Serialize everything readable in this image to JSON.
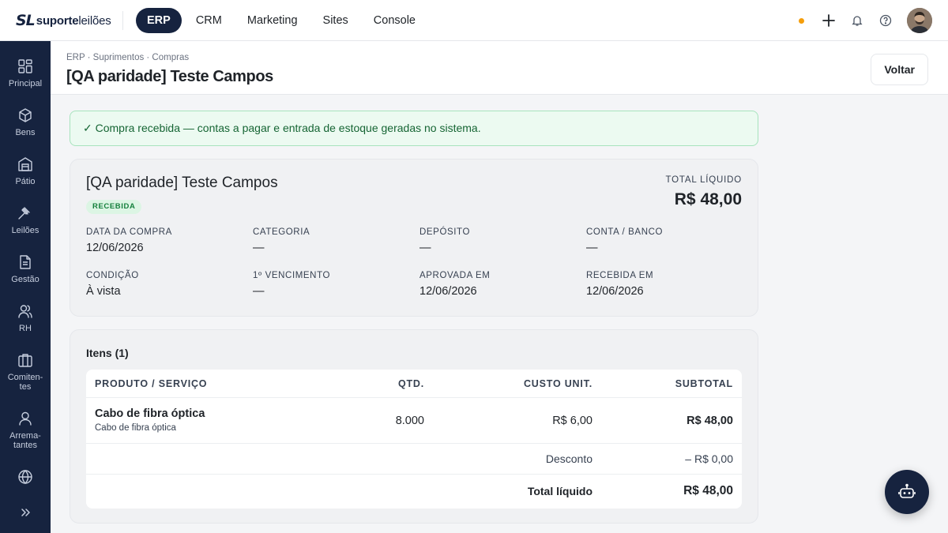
{
  "brand": {
    "mark": "SL",
    "name_bold": "suporte",
    "name_light": "leilões"
  },
  "topnav": [
    "ERP",
    "CRM",
    "Marketing",
    "Sites",
    "Console"
  ],
  "sidebar": [
    {
      "label": "Principal",
      "icon": "grid-icon"
    },
    {
      "label": "Bens",
      "icon": "box-icon"
    },
    {
      "label": "Pátio",
      "icon": "warehouse-icon"
    },
    {
      "label": "Leilões",
      "icon": "gavel-icon"
    },
    {
      "label": "Gestão",
      "icon": "document-icon"
    },
    {
      "label": "RH",
      "icon": "users-icon"
    },
    {
      "label": "Comiten-\ntes",
      "icon": "briefcase-icon"
    },
    {
      "label": "Arrema-\ntantes",
      "icon": "user-icon"
    },
    {
      "label": "",
      "icon": "globe-icon"
    }
  ],
  "header": {
    "breadcrumb": "ERP · Suprimentos · Compras",
    "title": "[QA paridade] Teste Campos",
    "back_label": "Voltar"
  },
  "alert": "✓ Compra recebida — contas a pagar e entrada de estoque geradas no sistema.",
  "summary": {
    "title": "[QA paridade] Teste Campos",
    "status": "RECEBIDA",
    "total_label": "TOTAL LÍQUIDO",
    "total_value": "R$ 48,00",
    "fields": [
      {
        "label": "DATA DA COMPRA",
        "value": "12/06/2026"
      },
      {
        "label": "CATEGORIA",
        "value": "—"
      },
      {
        "label": "DEPÓSITO",
        "value": "—"
      },
      {
        "label": "CONTA / BANCO",
        "value": "—"
      },
      {
        "label": "CONDIÇÃO",
        "value": "À vista"
      },
      {
        "label": "1º VENCIMENTO",
        "value": "—"
      },
      {
        "label": "APROVADA EM",
        "value": "12/06/2026"
      },
      {
        "label": "RECEBIDA EM",
        "value": "12/06/2026"
      }
    ]
  },
  "items": {
    "title": "Itens (1)",
    "columns": [
      "PRODUTO / SERVIÇO",
      "QTD.",
      "CUSTO UNIT.",
      "SUBTOTAL"
    ],
    "rows": [
      {
        "name": "Cabo de fibra óptica",
        "description": "Cabo de fibra óptica",
        "qty": "8.000",
        "unit_cost": "R$ 6,00",
        "subtotal": "R$ 48,00"
      }
    ],
    "discount_label": "Desconto",
    "discount_value": "– R$ 0,00",
    "net_label": "Total líquido",
    "net_value": "R$ 48,00"
  },
  "colors": {
    "navy": "#16233f",
    "success": "#166534",
    "warning_dot": "#f59e0b"
  }
}
